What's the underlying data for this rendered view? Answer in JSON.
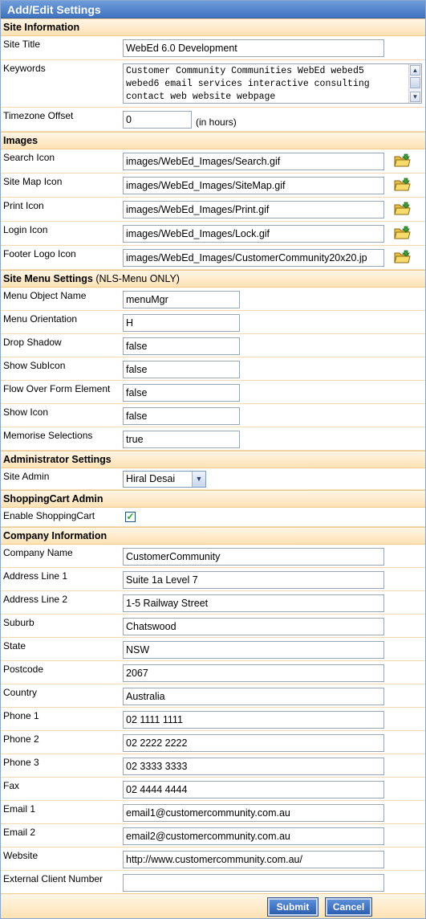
{
  "window": {
    "title": "Add/Edit Settings"
  },
  "sections": {
    "site_info": "Site Information",
    "images": "Images",
    "menu": "Site Menu Settings",
    "menu_note": "(NLS-Menu ONLY)",
    "admin": "Administrator Settings",
    "cart": "ShoppingCart Admin",
    "company": "Company Information"
  },
  "site": {
    "title_label": "Site Title",
    "title_value": "WebEd 6.0 Development",
    "keywords_label": "Keywords",
    "keywords_value": "Customer Community Communities WebEd webed5\nwebed6 email services interactive consulting\ncontact web website webpage",
    "tz_label": "Timezone Offset",
    "tz_value": "0",
    "tz_unit": "(in hours)"
  },
  "images": [
    {
      "label": "Search Icon",
      "value": "images/WebEd_Images/Search.gif"
    },
    {
      "label": "Site Map Icon",
      "value": "images/WebEd_Images/SiteMap.gif"
    },
    {
      "label": "Print Icon",
      "value": "images/WebEd_Images/Print.gif"
    },
    {
      "label": "Login Icon",
      "value": "images/WebEd_Images/Lock.gif"
    },
    {
      "label": "Footer Logo Icon",
      "value": "images/WebEd_Images/CustomerCommunity20x20.jp"
    }
  ],
  "menu": [
    {
      "label": "Menu Object Name",
      "value": "menuMgr"
    },
    {
      "label": "Menu Orientation",
      "value": "H"
    },
    {
      "label": "Drop Shadow",
      "value": "false"
    },
    {
      "label": "Show SubIcon",
      "value": "false"
    },
    {
      "label": "Flow Over Form Element",
      "value": "false"
    },
    {
      "label": "Show Icon",
      "value": "false"
    },
    {
      "label": "Memorise Selections",
      "value": "true"
    }
  ],
  "admin": {
    "label": "Site Admin",
    "value": "Hiral Desai"
  },
  "cart": {
    "label": "Enable ShoppingCart",
    "checked": true
  },
  "company": [
    {
      "label": "Company Name",
      "value": "CustomerCommunity"
    },
    {
      "label": "Address Line 1",
      "value": "Suite 1a Level 7"
    },
    {
      "label": "Address Line 2",
      "value": "1-5 Railway Street"
    },
    {
      "label": "Suburb",
      "value": "Chatswood"
    },
    {
      "label": "State",
      "value": "NSW"
    },
    {
      "label": "Postcode",
      "value": "2067"
    },
    {
      "label": "Country",
      "value": "Australia"
    },
    {
      "label": "Phone 1",
      "value": "02 1111 1111"
    },
    {
      "label": "Phone 2",
      "value": "02 2222 2222"
    },
    {
      "label": "Phone 3",
      "value": "02 3333 3333"
    },
    {
      "label": "Fax",
      "value": "02 4444 4444"
    },
    {
      "label": "Email 1",
      "value": "email1@customercommunity.com.au"
    },
    {
      "label": "Email 2",
      "value": "email2@customercommunity.com.au"
    },
    {
      "label": "Website",
      "value": "http://www.customercommunity.com.au/"
    },
    {
      "label": "External Client Number",
      "value": ""
    }
  ],
  "buttons": {
    "submit": "Submit",
    "cancel": "Cancel"
  }
}
